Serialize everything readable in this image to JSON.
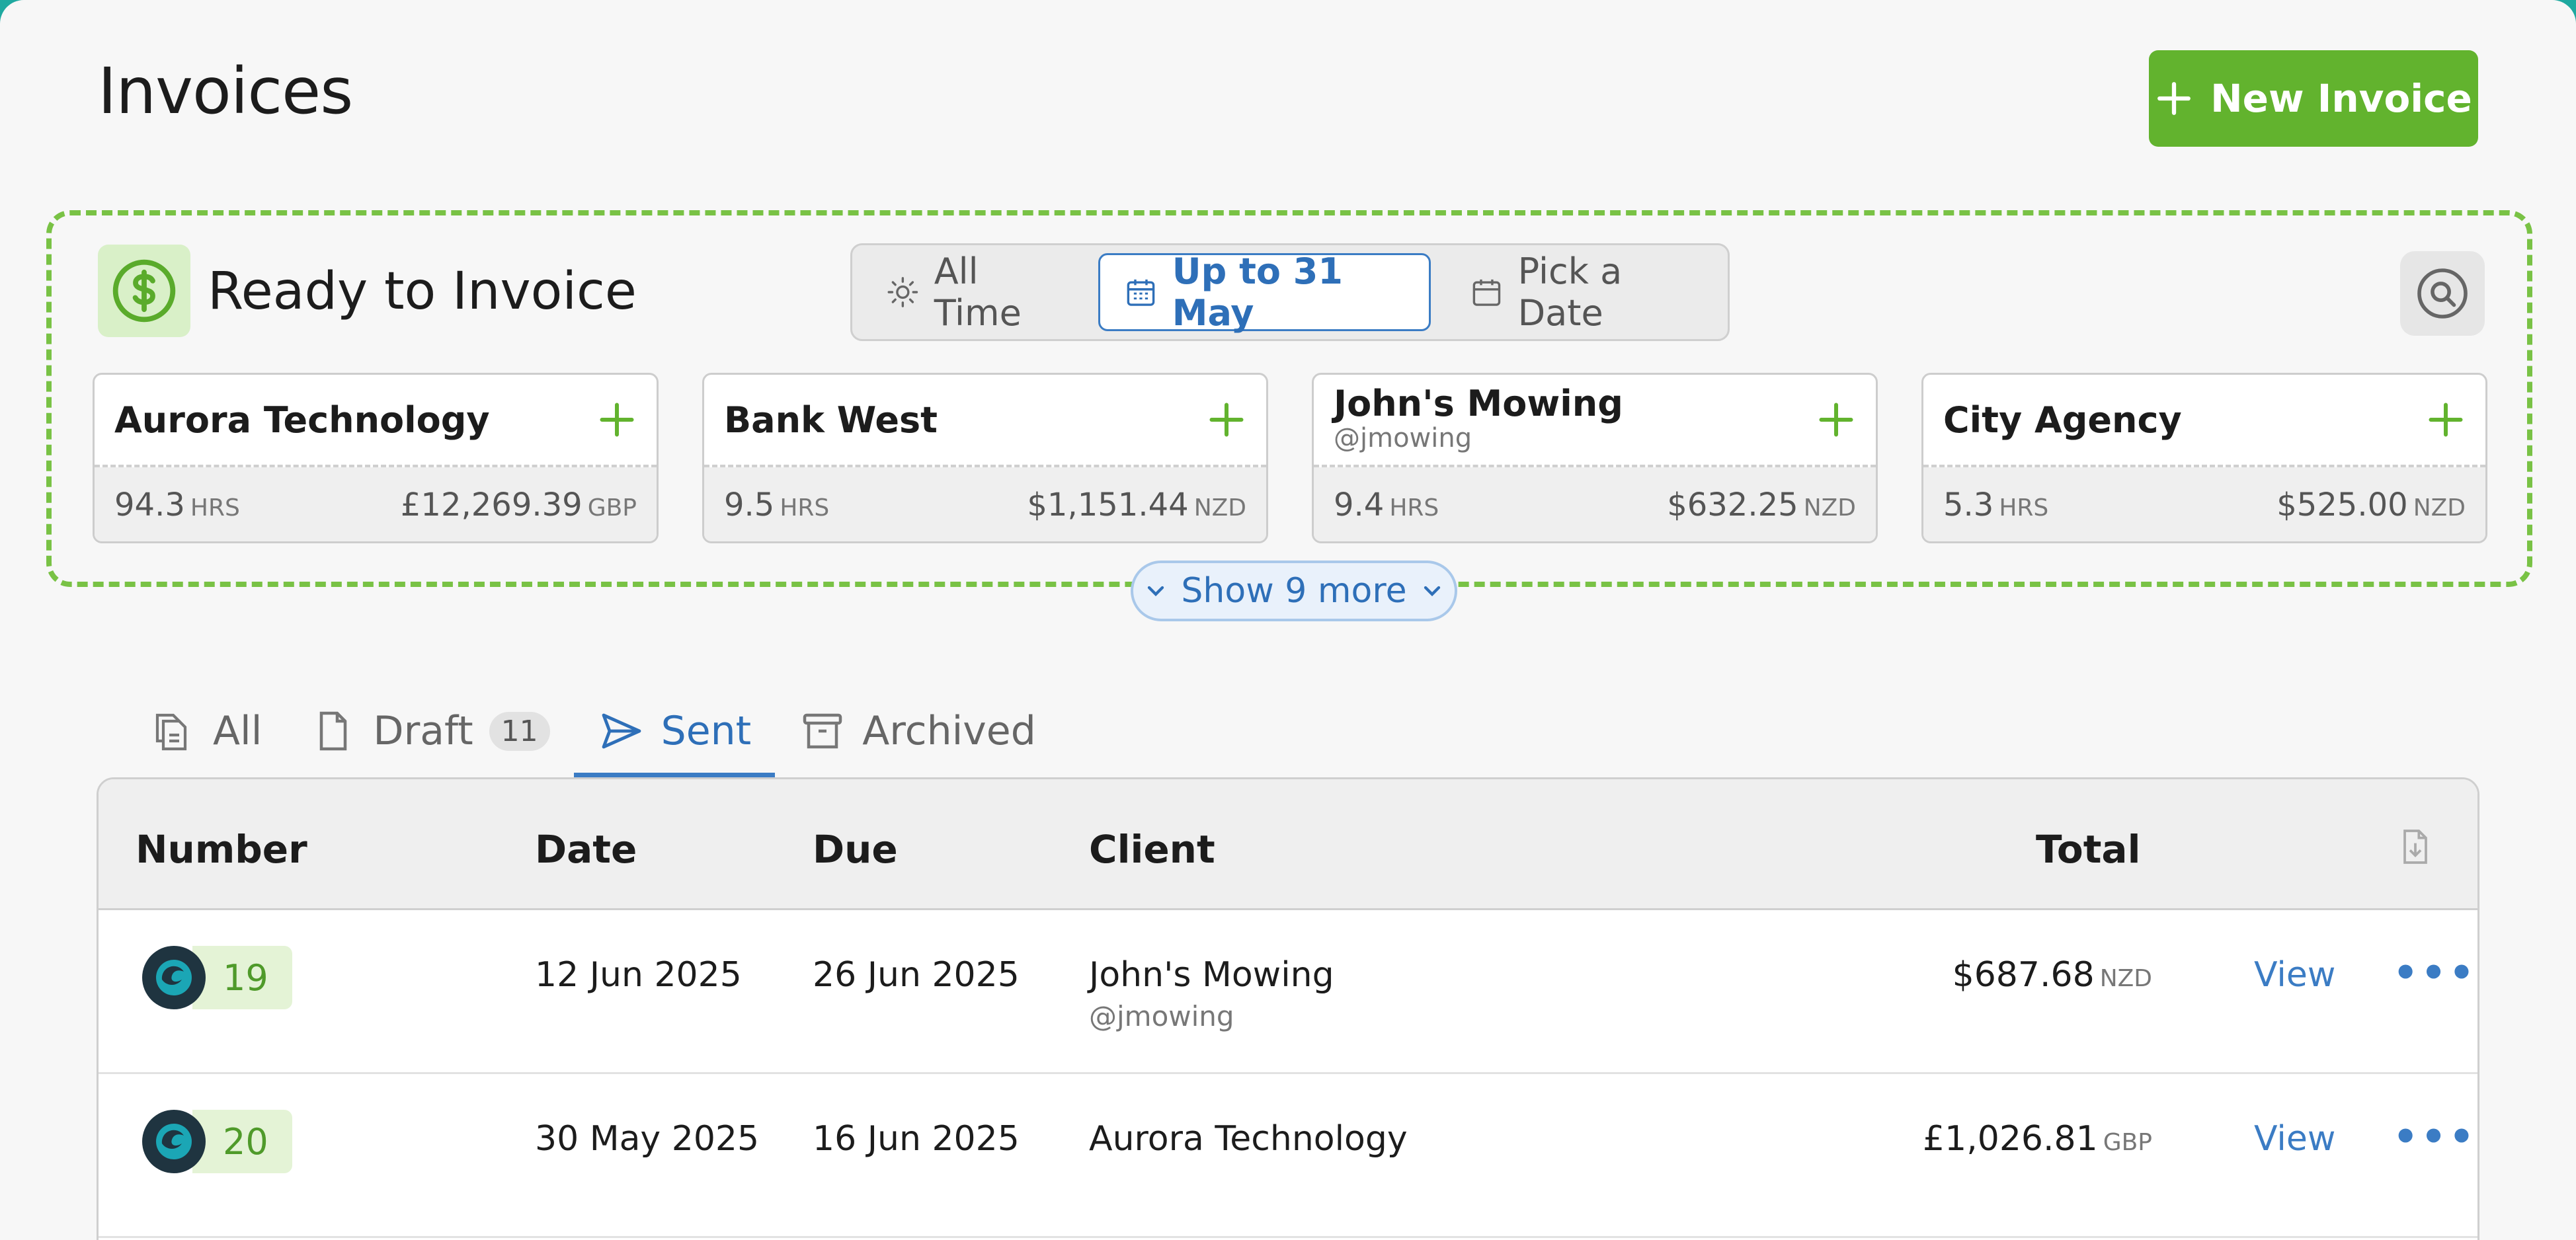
{
  "page": {
    "title": "Invoices",
    "new_button": "New Invoice"
  },
  "ready": {
    "title": "Ready to Invoice",
    "filters": [
      {
        "label": "All Time",
        "icon": "sun-icon",
        "active": false
      },
      {
        "label": "Up to 31 May",
        "icon": "calendar-grid-icon",
        "active": true
      },
      {
        "label": "Pick a Date",
        "icon": "calendar-icon",
        "active": false
      }
    ],
    "cards": [
      {
        "name": "Aurora Technology",
        "handle": "",
        "hours": "94.3",
        "hours_unit": "HRS",
        "amount": "£12,269.39",
        "currency": "GBP"
      },
      {
        "name": "Bank West",
        "handle": "",
        "hours": "9.5",
        "hours_unit": "HRS",
        "amount": "$1,151.44",
        "currency": "NZD"
      },
      {
        "name": "John's Mowing",
        "handle": "@jmowing",
        "hours": "9.4",
        "hours_unit": "HRS",
        "amount": "$632.25",
        "currency": "NZD"
      },
      {
        "name": "City Agency",
        "handle": "",
        "hours": "5.3",
        "hours_unit": "HRS",
        "amount": "$525.00",
        "currency": "NZD"
      }
    ],
    "show_more": "Show 9 more"
  },
  "tabs": [
    {
      "label": "All",
      "icon": "files-icon",
      "badge": ""
    },
    {
      "label": "Draft",
      "icon": "document-icon",
      "badge": "11"
    },
    {
      "label": "Sent",
      "icon": "send-icon",
      "badge": ""
    },
    {
      "label": "Archived",
      "icon": "archive-icon",
      "badge": ""
    }
  ],
  "table": {
    "headers": {
      "number": "Number",
      "date": "Date",
      "due": "Due",
      "client": "Client",
      "total": "Total"
    },
    "rows": [
      {
        "number": "19",
        "date": "12 Jun 2025",
        "due": "26 Jun 2025",
        "client": "John's Mowing",
        "handle": "@jmowing",
        "total": "$687.68",
        "currency": "NZD",
        "action": "View"
      },
      {
        "number": "20",
        "date": "30 May 2025",
        "due": "16 Jun 2025",
        "client": "Aurora Technology",
        "handle": "",
        "total": "£1,026.81",
        "currency": "GBP",
        "action": "View"
      }
    ]
  },
  "colors": {
    "accent_green": "#62b32e",
    "accent_blue": "#3b7cc4"
  }
}
